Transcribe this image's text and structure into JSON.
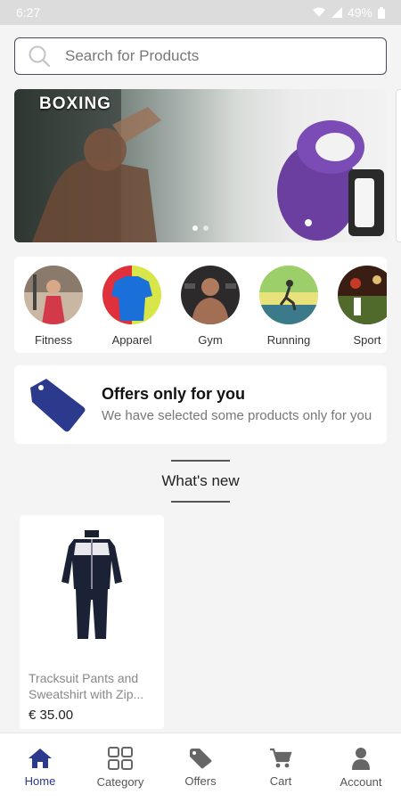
{
  "status_bar": {
    "time": "6:27",
    "battery": "49%"
  },
  "search": {
    "placeholder": "Search for Products"
  },
  "banner": {
    "title": "BOXING"
  },
  "categories": [
    {
      "label": "Fitness"
    },
    {
      "label": "Apparel"
    },
    {
      "label": "Gym"
    },
    {
      "label": "Running"
    },
    {
      "label": "Sport"
    }
  ],
  "offers": {
    "title": "Offers only for you",
    "subtitle": "We have selected some products only for you"
  },
  "whats_new": {
    "title": "What's new"
  },
  "products": [
    {
      "name": "Tracksuit Pants and Sweatshirt with Zip...",
      "price": "€ 35.00"
    }
  ],
  "bottom_nav": [
    {
      "label": "Home",
      "icon": "home-icon"
    },
    {
      "label": "Category",
      "icon": "grid-icon"
    },
    {
      "label": "Offers",
      "icon": "tag-icon"
    },
    {
      "label": "Cart",
      "icon": "cart-icon"
    },
    {
      "label": "Account",
      "icon": "account-icon"
    }
  ],
  "colors": {
    "accent": "#2b3a8c",
    "banner_glove": "#6a3fa0"
  }
}
